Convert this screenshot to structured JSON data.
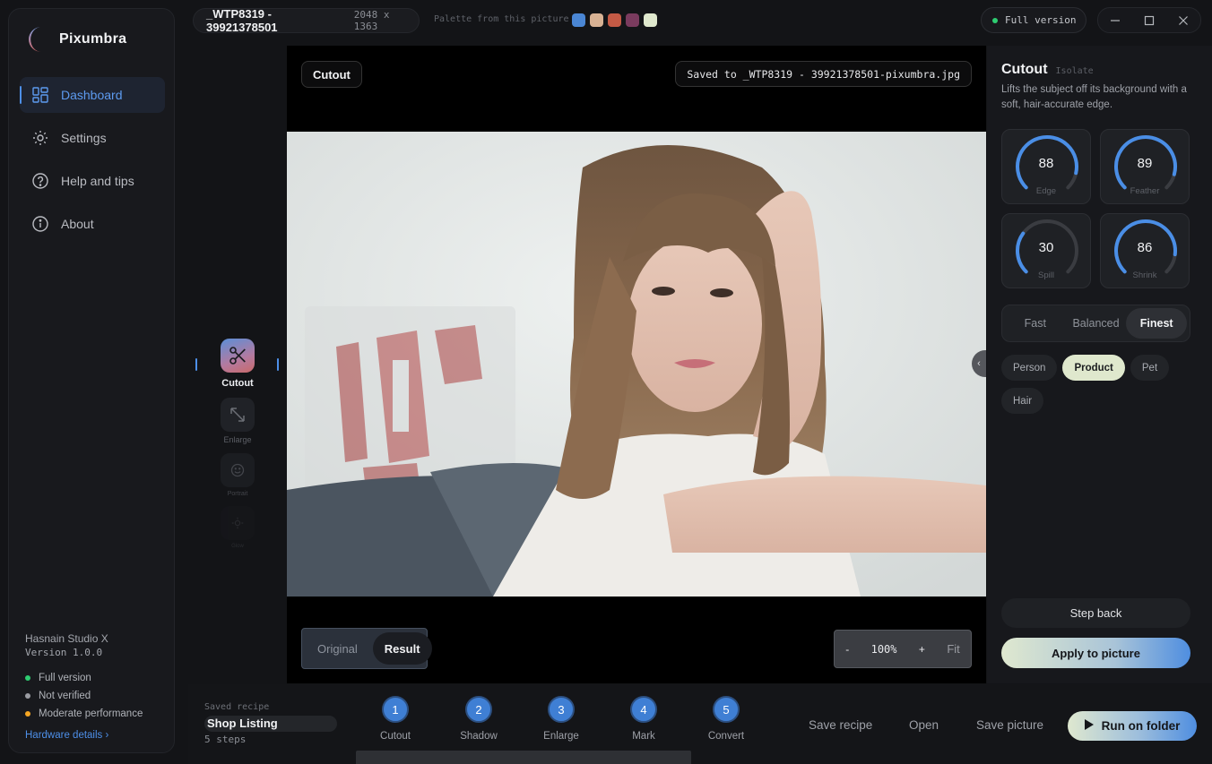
{
  "app": {
    "name": "Pixumbra"
  },
  "sidebar": {
    "items": [
      {
        "label": "Dashboard",
        "icon": "dashboard-grid-icon",
        "active": true
      },
      {
        "label": "Settings",
        "icon": "gear-icon",
        "active": false
      },
      {
        "label": "Help and tips",
        "icon": "help-circle-icon",
        "active": false
      },
      {
        "label": "About",
        "icon": "info-circle-icon",
        "active": false
      }
    ],
    "footer": {
      "studio": "Hasnain Studio X",
      "version": "Version 1.0.0",
      "statuses": [
        {
          "label": "Full version",
          "color": "#2ecc71"
        },
        {
          "label": "Not verified",
          "color": "#9a9ca2"
        },
        {
          "label": "Moderate performance",
          "color": "#f5a623"
        }
      ],
      "hardware_link": "Hardware details ›"
    }
  },
  "topbar": {
    "file_name": "_WTP8319 - 39921378501",
    "dimensions": "2048 x 1363",
    "palette_label": "Palette from this picture",
    "palette": [
      "#4a86d4",
      "#d8b294",
      "#c45a45",
      "#7a3b5e",
      "#dfe8cd"
    ],
    "license_badge": "Full version",
    "license_color": "#2ecc71"
  },
  "rail": {
    "tools": [
      {
        "label": "Cutout",
        "icon": "scissors-icon",
        "active": true
      },
      {
        "label": "Enlarge",
        "icon": "expand-arrows-icon",
        "active": false
      },
      {
        "label": "Portrait",
        "icon": "smile-face-icon",
        "active": false
      },
      {
        "label": "Glow",
        "icon": "sun-icon",
        "active": false
      }
    ]
  },
  "canvas": {
    "tool_tag": "Cutout",
    "saved_to": "Saved to _WTP8319 - 39921378501-pixumbra.jpg",
    "compare": {
      "original": "Original",
      "result": "Result",
      "selected": "Result"
    },
    "zoom": {
      "minus": "-",
      "level": "100%",
      "plus": "+",
      "fit": "Fit"
    },
    "collapse": "‹"
  },
  "panel": {
    "title": "Cutout",
    "subtitle": "Isolate",
    "description": "Lifts the subject off its background with a soft, hair-accurate edge.",
    "knobs": [
      {
        "label": "Edge",
        "value": 88
      },
      {
        "label": "Feather",
        "value": 89
      },
      {
        "label": "Spill",
        "value": 30
      },
      {
        "label": "Shrink",
        "value": 86
      }
    ],
    "accent": "#4a8ee6",
    "quality": {
      "options": [
        "Fast",
        "Balanced",
        "Finest"
      ],
      "selected": "Finest"
    },
    "subjects": {
      "options": [
        "Person",
        "Product",
        "Pet",
        "Hair"
      ],
      "selected": "Product"
    },
    "step_back": "Step back",
    "apply": "Apply to picture"
  },
  "bottom": {
    "recipe_label": "Saved recipe",
    "recipe_name": "Shop Listing",
    "recipe_steps": "5 steps",
    "steps": [
      {
        "num": "1",
        "name": "Cutout"
      },
      {
        "num": "2",
        "name": "Shadow"
      },
      {
        "num": "3",
        "name": "Enlarge"
      },
      {
        "num": "4",
        "name": "Mark"
      },
      {
        "num": "5",
        "name": "Convert"
      }
    ],
    "save_recipe": "Save recipe",
    "open": "Open",
    "save_picture": "Save picture",
    "run": "Run on folder"
  }
}
